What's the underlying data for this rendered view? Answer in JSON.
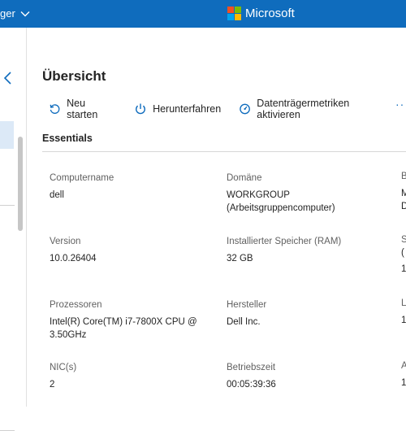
{
  "topbar": {
    "left_text": "ger",
    "brand_name": "Microsoft",
    "logo_colors": [
      "#f25022",
      "#7fba00",
      "#00a4ef",
      "#ffb900"
    ]
  },
  "page": {
    "title": "Übersicht"
  },
  "toolbar": {
    "restart_label": "Neu starten",
    "shutdown_label": "Herunterfahren",
    "disk_metrics_label": "Datenträgermetriken aktivieren",
    "more_label": "···"
  },
  "essentials": {
    "title": "Essentials",
    "computer_name": {
      "label": "Computername",
      "value": "dell"
    },
    "domain": {
      "label": "Domäne",
      "value_line1": "WORKGROUP",
      "value_line2": "(Arbeitsgruppencomputer)"
    },
    "version": {
      "label": "Version",
      "value": "10.0.26404"
    },
    "ram": {
      "label": "Installierter Speicher (RAM)",
      "value": "32 GB"
    },
    "processors": {
      "label": "Prozessoren",
      "value_line1": "Intel(R) Core(TM) i7-7800X CPU @",
      "value_line2": "3.50GHz"
    },
    "manufacturer": {
      "label": "Hersteller",
      "value": "Dell Inc."
    },
    "nics": {
      "label": "NIC(s)",
      "value": "2"
    },
    "uptime": {
      "label": "Betriebszeit",
      "value": "00:05:39:36"
    }
  },
  "edge_column": {
    "row1_label": "B",
    "row1_val1": "M",
    "row1_val2": "D",
    "row2_label": "S",
    "row2_val1": "(",
    "row2_val2": "1",
    "row3_label": "L",
    "row3_val1": "1",
    "row4_label": "A",
    "row4_val1": "1"
  },
  "colors": {
    "accent": "#0f6cbd",
    "selected_nav": "#dce9f7"
  }
}
